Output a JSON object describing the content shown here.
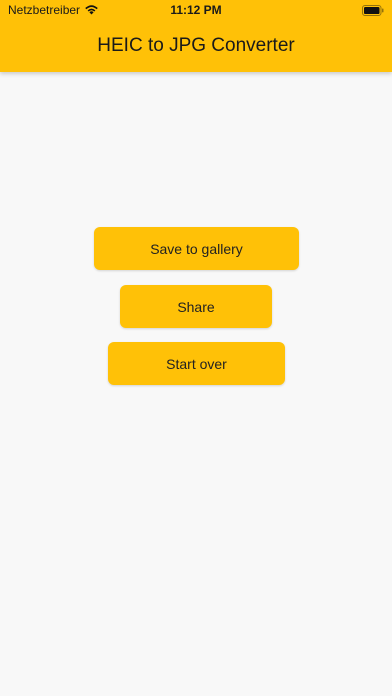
{
  "status_bar": {
    "carrier": "Netzbetreiber",
    "time": "11:12 PM",
    "wifi_icon": "wifi-icon",
    "battery_icon": "battery-icon"
  },
  "header": {
    "title": "HEIC to JPG Converter"
  },
  "actions": {
    "save_label": "Save to gallery",
    "share_label": "Share",
    "start_over_label": "Start over"
  },
  "colors": {
    "accent": "#ffc107",
    "background": "#f8f8f8"
  }
}
